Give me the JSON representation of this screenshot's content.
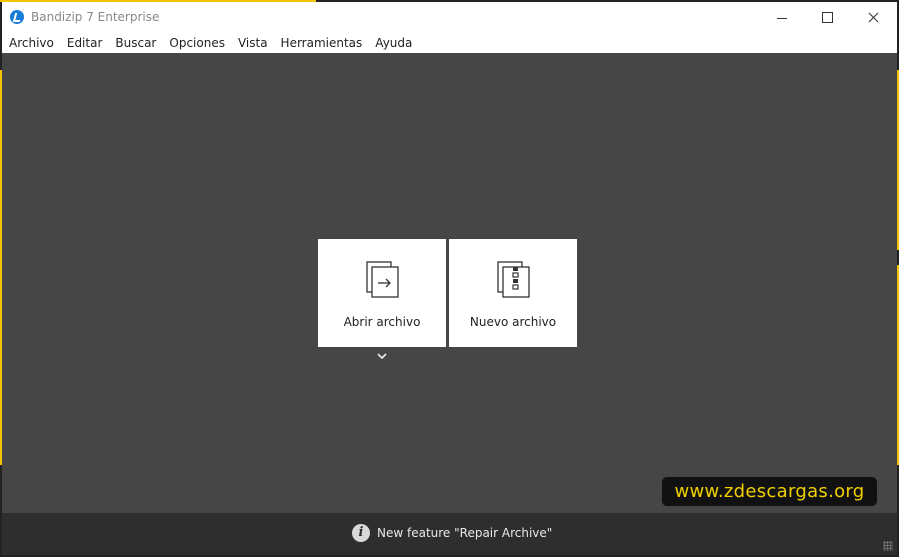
{
  "window": {
    "title": "Bandizip 7 Enterprise",
    "controls": [
      "minimize-icon",
      "maximize-icon",
      "close-icon"
    ]
  },
  "menu": [
    "Archivo",
    "Editar",
    "Buscar",
    "Opciones",
    "Vista",
    "Herramientas",
    "Ayuda"
  ],
  "cards": {
    "open": {
      "label": "Abrir archivo",
      "icon": "open-archive-icon"
    },
    "new": {
      "label": "Nuevo archivo",
      "icon": "new-archive-icon"
    }
  },
  "dropdown_icon": "chevron-down-icon",
  "watermark": "www.zdescargas.org",
  "footer": {
    "icon": "info-icon",
    "icon_glyph": "i",
    "text": "New feature \"Repair Archive\""
  },
  "colors": {
    "main_bg": "#464646",
    "footer_bg": "#2e2e2e",
    "accent_yellow": "#f5c400",
    "watermark_text": "#f0d000"
  }
}
